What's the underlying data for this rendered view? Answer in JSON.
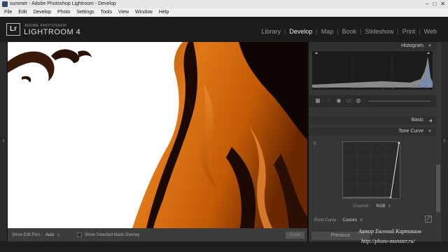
{
  "window": {
    "title": "summer - Adobe Photoshop Lightroom - Develop",
    "controls": [
      "–",
      "□",
      "✕"
    ]
  },
  "menu": [
    "File",
    "Edit",
    "Develop",
    "Photo",
    "Settings",
    "Tools",
    "View",
    "Window",
    "Help"
  ],
  "identity": {
    "logo": "Lr",
    "brand_small": "ADOBE PHOTOSHOP",
    "brand_big": "LIGHTROOM 4"
  },
  "modules": [
    {
      "label": "Library",
      "active": false
    },
    {
      "label": "Develop",
      "active": true
    },
    {
      "label": "Map",
      "active": false
    },
    {
      "label": "Book",
      "active": false
    },
    {
      "label": "Slideshow",
      "active": false
    },
    {
      "label": "Print",
      "active": false
    },
    {
      "label": "Web",
      "active": false
    }
  ],
  "toolbar": {
    "show_edit_pins_label": "Show Edit Pins :",
    "show_edit_pins_value": "Auto",
    "mask_overlay_label": "Show Selected Mask Overlay",
    "done_label": "Done"
  },
  "panel": {
    "histogram_title": "Histogram",
    "iso": "ISO 100",
    "focal": "50 mm",
    "aperture": "ƒ / 7.1",
    "shutter": "1/160 sec",
    "basic_title": "Basic",
    "tone_curve_title": "Tone Curve",
    "channel_label": "Channel :",
    "channel_value": "RGB",
    "point_curve_label": "Point Curve :",
    "point_curve_value": "Custom",
    "previous_label": "Previous"
  },
  "watermark": {
    "line1": "Автор Евгений Карташов",
    "line2": "http://photo-monster.ru/"
  }
}
